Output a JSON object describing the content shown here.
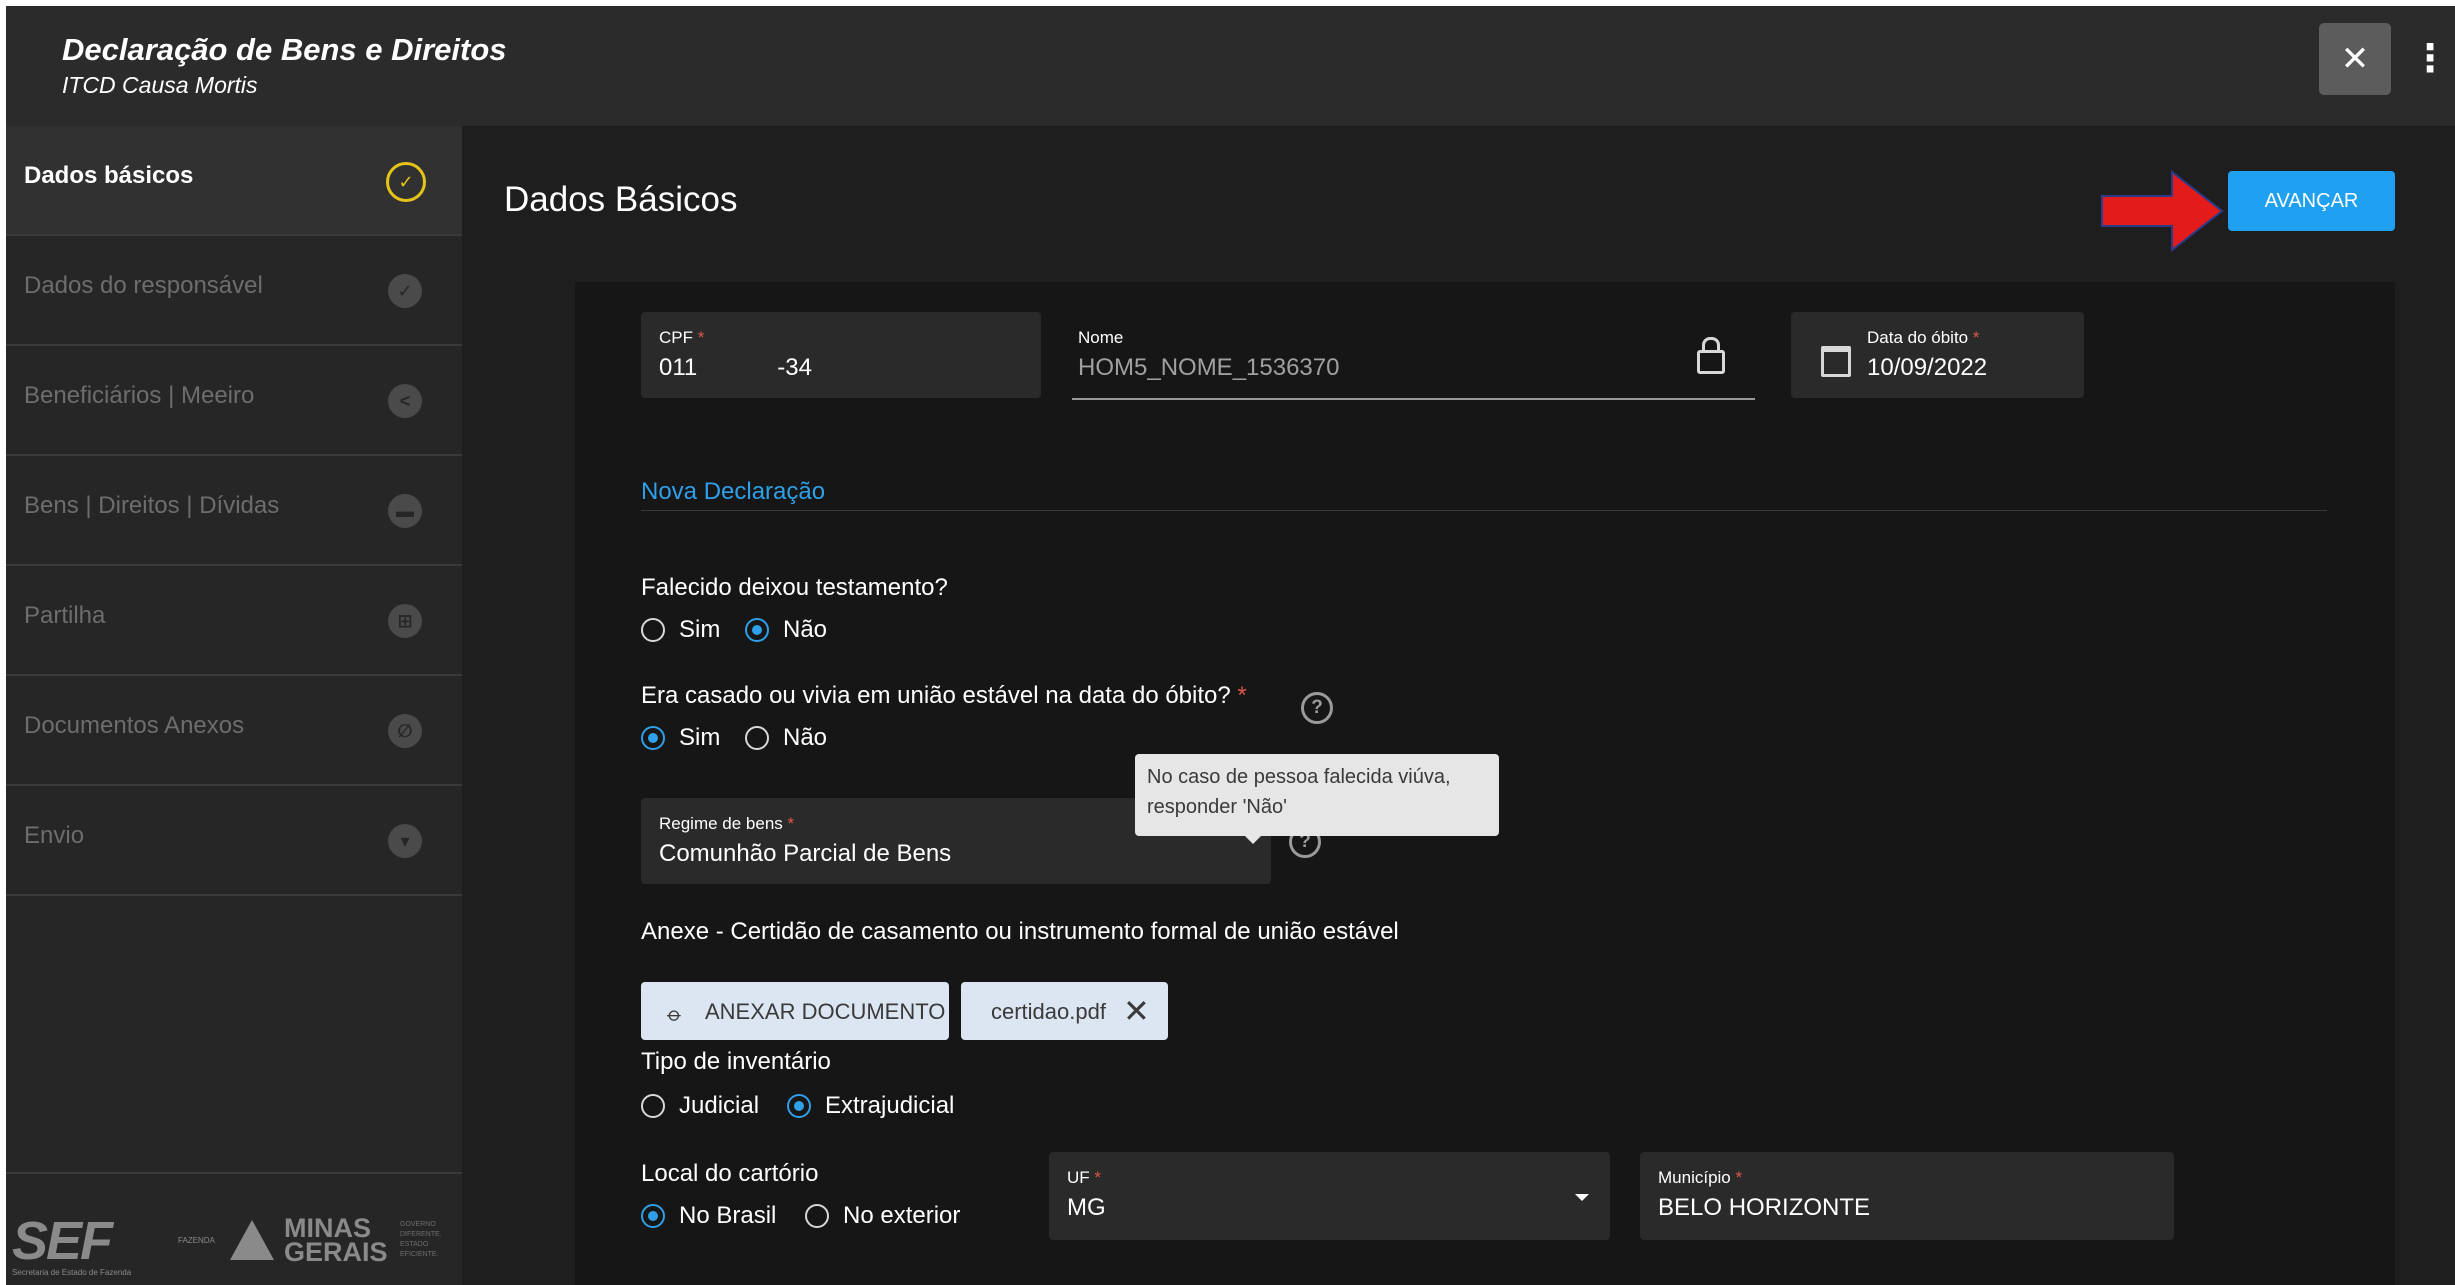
{
  "app": {
    "title": "Declaração de Bens e Direitos",
    "subtitle": "ITCD Causa Mortis"
  },
  "window": {
    "close_label": "✕",
    "menu_label": "⋮"
  },
  "sidebar": {
    "items": [
      {
        "label": "Dados básicos",
        "icon": "check-circle-icon",
        "active": true
      },
      {
        "label": "Dados do responsável",
        "icon": "check-icon"
      },
      {
        "label": "Beneficiários | Meeiro",
        "icon": "share-icon"
      },
      {
        "label": "Bens | Direitos | Dívidas",
        "icon": "briefcase-icon"
      },
      {
        "label": "Partilha",
        "icon": "table-icon"
      },
      {
        "label": "Documentos Anexos",
        "icon": "paperclip-icon"
      },
      {
        "label": "Envio",
        "icon": "send-icon"
      }
    ],
    "footer": {
      "sef_logo": "SEF",
      "sef_sub": "Secretaria de Estado de Fazenda",
      "fazenda": "FAZENDA",
      "mg_logo_line1": "MINAS",
      "mg_logo_line2": "GERAIS",
      "gov_text": "GOVERNO DIFERENTE. ESTADO EFICIENTE."
    }
  },
  "page": {
    "title": "Dados Básicos",
    "advance_label": "AVANÇAR"
  },
  "form": {
    "cpf": {
      "label": "CPF",
      "value": "011            -34"
    },
    "nome": {
      "label": "Nome",
      "value": "HOM5_NOME_1536370"
    },
    "data_obito": {
      "label": "Data do óbito",
      "value": "10/09/2022"
    },
    "section_title": "Nova Declaração",
    "testamento": {
      "question": "Falecido deixou testamento?",
      "options": [
        "Sim",
        "Não"
      ],
      "selected": "Não"
    },
    "casado": {
      "question": "Era casado ou vivia em união estável na data do óbito?",
      "options": [
        "Sim",
        "Não"
      ],
      "selected": "Sim"
    },
    "tooltip": "No caso de pessoa falecida viúva, responder 'Não'",
    "regime": {
      "label": "Regime de bens",
      "value": "Comunhão Parcial de Bens"
    },
    "anexo": {
      "label": "Anexe - Certidão de casamento ou instrumento formal de união estável",
      "button": "ANEXAR DOCUMENTO",
      "file": "certidao.pdf"
    },
    "inventario": {
      "question": "Tipo de inventário",
      "options": [
        "Judicial",
        "Extrajudicial"
      ],
      "selected": "Extrajudicial"
    },
    "local": {
      "question": "Local do cartório",
      "options": [
        "No Brasil",
        "No exterior"
      ],
      "selected": "No Brasil"
    },
    "uf": {
      "label": "UF",
      "value": "MG"
    },
    "municipio": {
      "label": "Município",
      "value": "BELO HORIZONTE"
    }
  },
  "colors": {
    "accent": "#20a0f0",
    "required": "#e0564a",
    "active_step": "#e6c319",
    "arrow": "#e31b1b"
  }
}
